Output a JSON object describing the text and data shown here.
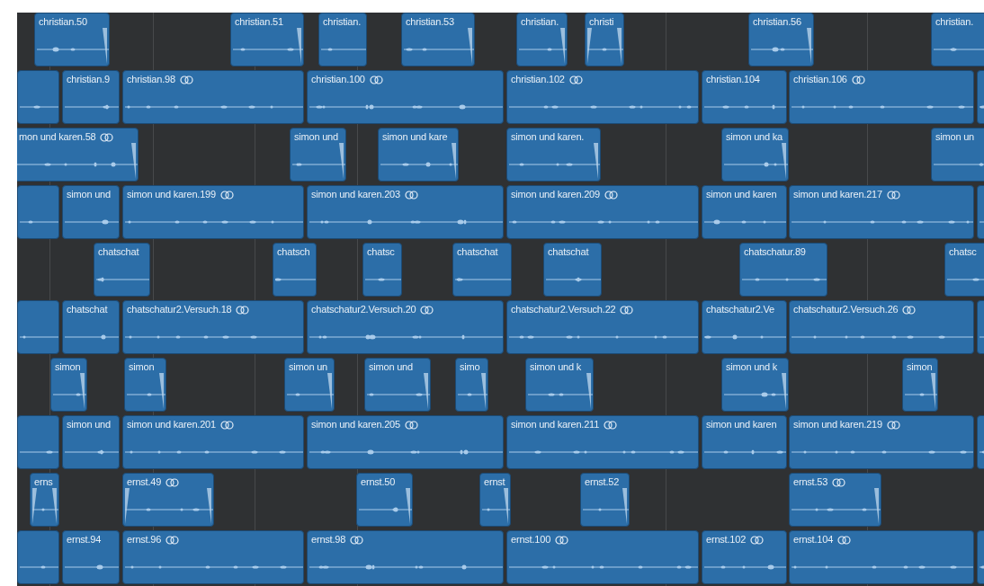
{
  "lanes": [
    {
      "regions": [
        {
          "title": "christian.50",
          "stereo": false,
          "fade_in": false,
          "fade_out": true
        },
        {
          "title": "christian.51",
          "stereo": false,
          "fade_in": false,
          "fade_out": true
        },
        {
          "title": "christian.",
          "stereo": false,
          "fade_in": false,
          "fade_out": false
        },
        {
          "title": "christian.53",
          "stereo": false,
          "fade_in": false,
          "fade_out": true
        },
        {
          "title": "christian.",
          "stereo": false,
          "fade_in": false,
          "fade_out": true
        },
        {
          "title": "christi",
          "stereo": false,
          "fade_in": true,
          "fade_out": true
        },
        {
          "title": "christian.56",
          "stereo": false,
          "fade_in": false,
          "fade_out": true
        },
        {
          "title": "christian.",
          "stereo": false,
          "fade_in": false,
          "fade_out": false
        }
      ]
    },
    {
      "regions": [
        {
          "stereo": false,
          "fade_in": false,
          "fade_out": false
        },
        {
          "title": "christian.9",
          "stereo": false,
          "fade_in": false,
          "fade_out": false
        },
        {
          "title": "christian.98",
          "stereo": true,
          "fade_in": false,
          "fade_out": false
        },
        {
          "title": "christian.100",
          "stereo": true,
          "fade_in": false,
          "fade_out": false
        },
        {
          "title": "christian.102",
          "stereo": true,
          "fade_in": false,
          "fade_out": false
        },
        {
          "title": "christian.104",
          "stereo": false,
          "fade_in": false,
          "fade_out": false
        },
        {
          "title": "christian.106",
          "stereo": true,
          "fade_in": false,
          "fade_out": false
        },
        {
          "stereo": false,
          "fade_in": false,
          "fade_out": false
        }
      ]
    },
    {
      "regions": [
        {
          "title": "mon und karen.58",
          "stereo": true,
          "fade_in": false,
          "fade_out": true
        },
        {
          "title": "simon und",
          "stereo": false,
          "fade_in": false,
          "fade_out": true
        },
        {
          "title": "simon und kare",
          "stereo": false,
          "fade_in": false,
          "fade_out": true
        },
        {
          "title": "simon und karen.",
          "stereo": false,
          "fade_in": false,
          "fade_out": true
        },
        {
          "title": "simon und ka",
          "stereo": false,
          "fade_in": false,
          "fade_out": true
        },
        {
          "title": "simon un",
          "stereo": false,
          "fade_in": false,
          "fade_out": false
        }
      ]
    },
    {
      "regions": [
        {
          "stereo": false,
          "fade_in": false,
          "fade_out": false
        },
        {
          "title": "simon und",
          "stereo": false,
          "fade_in": false,
          "fade_out": false
        },
        {
          "title": "simon und karen.199",
          "stereo": true,
          "fade_in": false,
          "fade_out": false
        },
        {
          "title": "simon und karen.203",
          "stereo": true,
          "fade_in": false,
          "fade_out": false
        },
        {
          "title": "simon und karen.209",
          "stereo": true,
          "fade_in": false,
          "fade_out": false
        },
        {
          "title": "simon und karen",
          "stereo": false,
          "fade_in": false,
          "fade_out": false
        },
        {
          "title": "simon und karen.217",
          "stereo": true,
          "fade_in": false,
          "fade_out": false
        },
        {
          "stereo": false,
          "fade_in": false,
          "fade_out": false
        }
      ]
    },
    {
      "regions": [
        {
          "title": "chatschat",
          "stereo": false,
          "fade_in": false,
          "fade_out": false
        },
        {
          "title": "chatsch",
          "stereo": false,
          "fade_in": false,
          "fade_out": false
        },
        {
          "title": "chatsc",
          "stereo": false,
          "fade_in": false,
          "fade_out": false
        },
        {
          "title": "chatschat",
          "stereo": false,
          "fade_in": false,
          "fade_out": false
        },
        {
          "title": "chatschat",
          "stereo": false,
          "fade_in": false,
          "fade_out": false
        },
        {
          "title": "chatschatur.89",
          "stereo": false,
          "fade_in": false,
          "fade_out": false
        },
        {
          "title": "chatsc",
          "stereo": false,
          "fade_in": false,
          "fade_out": false
        }
      ]
    },
    {
      "regions": [
        {
          "stereo": false,
          "fade_in": false,
          "fade_out": false
        },
        {
          "title": "chatschat",
          "stereo": false,
          "fade_in": false,
          "fade_out": false
        },
        {
          "title": "chatschatur2.Versuch.18",
          "stereo": true,
          "fade_in": false,
          "fade_out": false
        },
        {
          "title": "chatschatur2.Versuch.20",
          "stereo": true,
          "fade_in": false,
          "fade_out": false
        },
        {
          "title": "chatschatur2.Versuch.22",
          "stereo": true,
          "fade_in": false,
          "fade_out": false
        },
        {
          "title": "chatschatur2.Ve",
          "stereo": false,
          "fade_in": false,
          "fade_out": false
        },
        {
          "title": "chatschatur2.Versuch.26",
          "stereo": true,
          "fade_in": false,
          "fade_out": false
        },
        {
          "stereo": false,
          "fade_in": false,
          "fade_out": false
        }
      ]
    },
    {
      "regions": [
        {
          "title": "simon",
          "stereo": false,
          "fade_in": false,
          "fade_out": true
        },
        {
          "title": "simon",
          "stereo": false,
          "fade_in": false,
          "fade_out": true
        },
        {
          "title": "simon un",
          "stereo": false,
          "fade_in": false,
          "fade_out": true
        },
        {
          "title": "simon und",
          "stereo": false,
          "fade_in": false,
          "fade_out": true
        },
        {
          "title": "simo",
          "stereo": false,
          "fade_in": false,
          "fade_out": true
        },
        {
          "title": "simon und k",
          "stereo": false,
          "fade_in": false,
          "fade_out": true
        },
        {
          "title": "simon und k",
          "stereo": false,
          "fade_in": false,
          "fade_out": true
        },
        {
          "title": "simon",
          "stereo": false,
          "fade_in": false,
          "fade_out": true
        }
      ]
    },
    {
      "regions": [
        {
          "stereo": false,
          "fade_in": false,
          "fade_out": false
        },
        {
          "title": "simon und",
          "stereo": false,
          "fade_in": false,
          "fade_out": false
        },
        {
          "title": "simon und karen.201",
          "stereo": true,
          "fade_in": false,
          "fade_out": false
        },
        {
          "title": "simon und karen.205",
          "stereo": true,
          "fade_in": false,
          "fade_out": false
        },
        {
          "title": "simon und karen.211",
          "stereo": true,
          "fade_in": false,
          "fade_out": false
        },
        {
          "title": "simon und karen",
          "stereo": false,
          "fade_in": false,
          "fade_out": false
        },
        {
          "title": "simon und karen.219",
          "stereo": true,
          "fade_in": false,
          "fade_out": false
        },
        {
          "stereo": false,
          "fade_in": false,
          "fade_out": false
        }
      ]
    },
    {
      "regions": [
        {
          "title": "erns",
          "stereo": false,
          "fade_in": true,
          "fade_out": true
        },
        {
          "title": "ernst.49",
          "stereo": true,
          "fade_in": true,
          "fade_out": true
        },
        {
          "title": "ernst.50",
          "stereo": false,
          "fade_in": false,
          "fade_out": true
        },
        {
          "title": "ernst",
          "stereo": false,
          "fade_in": false,
          "fade_out": true
        },
        {
          "title": "ernst.52",
          "stereo": false,
          "fade_in": false,
          "fade_out": true
        },
        {
          "title": "ernst.53",
          "stereo": true,
          "fade_in": false,
          "fade_out": true
        }
      ]
    },
    {
      "regions": [
        {
          "stereo": false,
          "fade_in": false,
          "fade_out": false
        },
        {
          "title": "ernst.94",
          "stereo": false,
          "fade_in": false,
          "fade_out": false
        },
        {
          "title": "ernst.96",
          "stereo": true,
          "fade_in": false,
          "fade_out": false
        },
        {
          "title": "ernst.98",
          "stereo": true,
          "fade_in": false,
          "fade_out": false
        },
        {
          "title": "ernst.100",
          "stereo": true,
          "fade_in": false,
          "fade_out": false
        },
        {
          "title": "ernst.102",
          "stereo": true,
          "fade_in": false,
          "fade_out": false
        },
        {
          "title": "ernst.104",
          "stereo": true,
          "fade_in": false,
          "fade_out": false
        },
        {
          "stereo": false,
          "fade_in": false,
          "fade_out": false
        }
      ]
    }
  ]
}
